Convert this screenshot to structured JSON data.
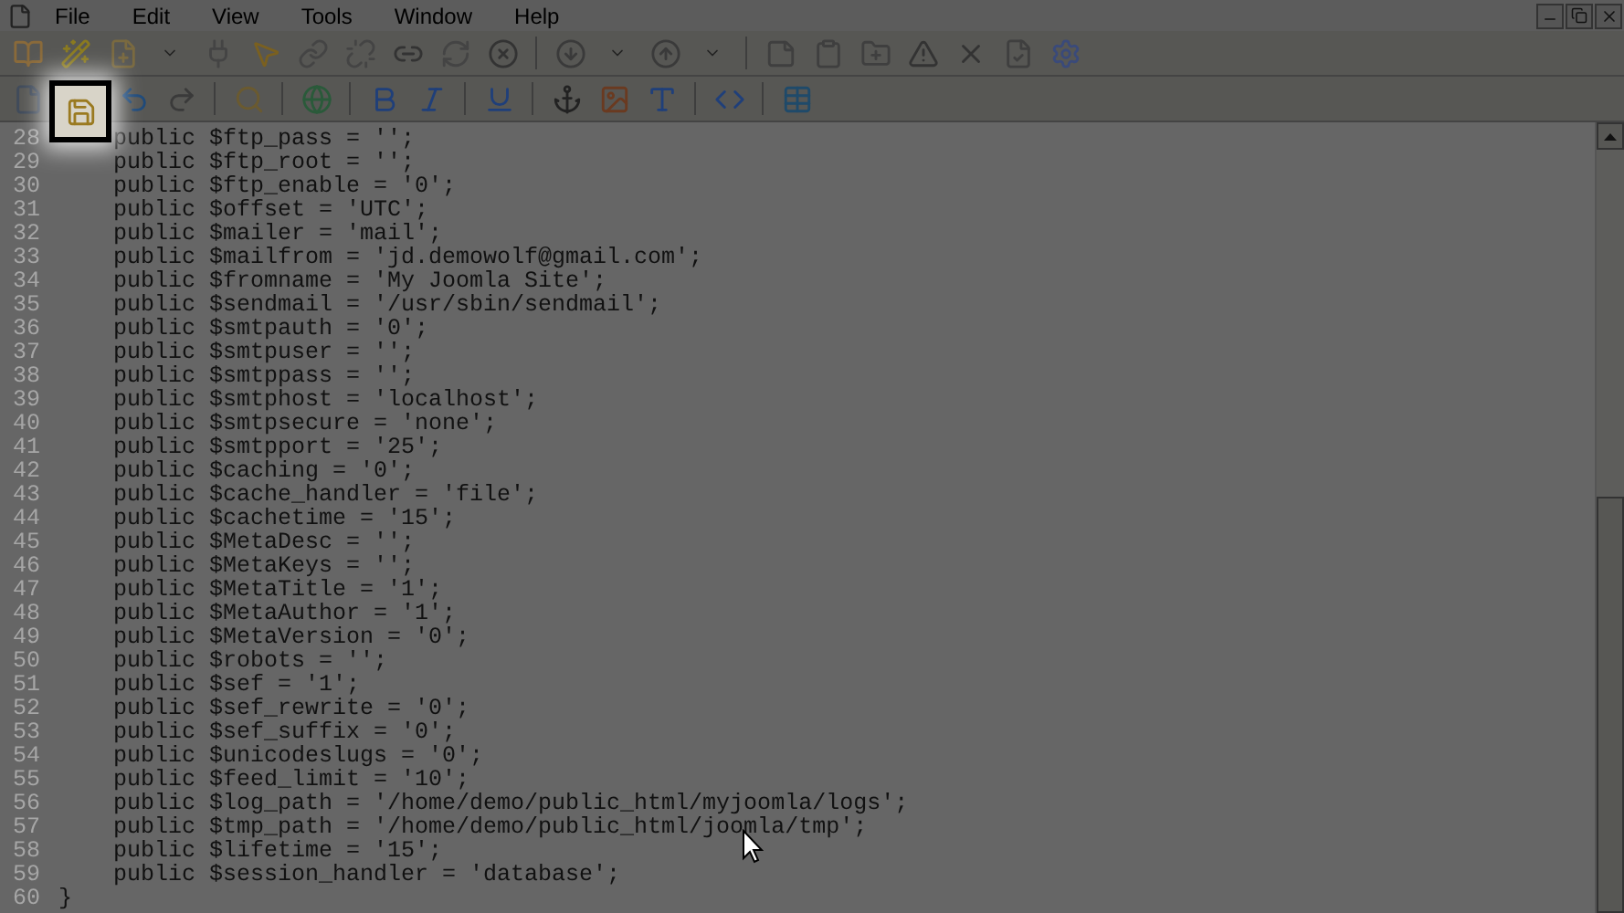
{
  "menu": [
    "File",
    "Edit",
    "View",
    "Tools",
    "Window",
    "Help"
  ],
  "toolbar_1": [
    {
      "kind": "book",
      "highlighted": false
    },
    {
      "kind": "wand",
      "highlighted": false
    },
    {
      "kind": "newfile",
      "highlighted": false
    },
    {
      "kind": "caret",
      "highlighted": false
    },
    {
      "kind": "plug",
      "highlighted": false
    },
    {
      "kind": "pointer",
      "highlighted": false
    },
    {
      "kind": "link",
      "highlighted": false
    },
    {
      "kind": "unlink",
      "highlighted": false
    },
    {
      "kind": "url",
      "highlighted": false
    },
    {
      "kind": "refresh",
      "highlighted": false
    },
    {
      "kind": "stop",
      "highlighted": false
    },
    {
      "kind": "sep"
    },
    {
      "kind": "down",
      "highlighted": false
    },
    {
      "kind": "caret",
      "highlighted": false
    },
    {
      "kind": "up",
      "highlighted": false
    },
    {
      "kind": "caret",
      "highlighted": false
    },
    {
      "kind": "sep"
    },
    {
      "kind": "notes",
      "highlighted": false
    },
    {
      "kind": "clipboard",
      "highlighted": false
    },
    {
      "kind": "folder",
      "highlighted": false
    },
    {
      "kind": "alert",
      "highlighted": false
    },
    {
      "kind": "close",
      "highlighted": false
    },
    {
      "kind": "check",
      "highlighted": false
    },
    {
      "kind": "gear",
      "highlighted": false
    }
  ],
  "toolbar_2": [
    {
      "kind": "page",
      "highlighted": false
    },
    {
      "kind": "save",
      "highlighted": true
    },
    {
      "kind": "undo",
      "highlighted": false
    },
    {
      "kind": "redo",
      "highlighted": false
    },
    {
      "kind": "sep"
    },
    {
      "kind": "find",
      "highlighted": false
    },
    {
      "kind": "sep"
    },
    {
      "kind": "globe",
      "highlighted": false
    },
    {
      "kind": "sep"
    },
    {
      "kind": "bold",
      "highlighted": false
    },
    {
      "kind": "italic",
      "highlighted": false
    },
    {
      "kind": "sep"
    },
    {
      "kind": "underline",
      "highlighted": false
    },
    {
      "kind": "sep"
    },
    {
      "kind": "anchor",
      "highlighted": false
    },
    {
      "kind": "image",
      "highlighted": false
    },
    {
      "kind": "font",
      "highlighted": false
    },
    {
      "kind": "sep"
    },
    {
      "kind": "code",
      "highlighted": false
    },
    {
      "kind": "sep"
    },
    {
      "kind": "table",
      "highlighted": false
    }
  ],
  "code_lines": [
    {
      "number": "28",
      "text": "    public $ftp_pass = '';"
    },
    {
      "number": "29",
      "text": "    public $ftp_root = '';"
    },
    {
      "number": "30",
      "text": "    public $ftp_enable = '0';"
    },
    {
      "number": "31",
      "text": "    public $offset = 'UTC';"
    },
    {
      "number": "32",
      "text": "    public $mailer = 'mail';"
    },
    {
      "number": "33",
      "text": "    public $mailfrom = 'jd.demowolf@gmail.com';"
    },
    {
      "number": "34",
      "text": "    public $fromname = 'My Joomla Site';"
    },
    {
      "number": "35",
      "text": "    public $sendmail = '/usr/sbin/sendmail';"
    },
    {
      "number": "36",
      "text": "    public $smtpauth = '0';"
    },
    {
      "number": "37",
      "text": "    public $smtpuser = '';"
    },
    {
      "number": "38",
      "text": "    public $smtppass = '';"
    },
    {
      "number": "39",
      "text": "    public $smtphost = 'localhost';"
    },
    {
      "number": "40",
      "text": "    public $smtpsecure = 'none';"
    },
    {
      "number": "41",
      "text": "    public $smtpport = '25';"
    },
    {
      "number": "42",
      "text": "    public $caching = '0';"
    },
    {
      "number": "43",
      "text": "    public $cache_handler = 'file';"
    },
    {
      "number": "44",
      "text": "    public $cachetime = '15';"
    },
    {
      "number": "45",
      "text": "    public $MetaDesc = '';"
    },
    {
      "number": "46",
      "text": "    public $MetaKeys = '';"
    },
    {
      "number": "47",
      "text": "    public $MetaTitle = '1';"
    },
    {
      "number": "48",
      "text": "    public $MetaAuthor = '1';"
    },
    {
      "number": "49",
      "text": "    public $MetaVersion = '0';"
    },
    {
      "number": "50",
      "text": "    public $robots = '';"
    },
    {
      "number": "51",
      "text": "    public $sef = '1';"
    },
    {
      "number": "52",
      "text": "    public $sef_rewrite = '0';"
    },
    {
      "number": "53",
      "text": "    public $sef_suffix = '0';"
    },
    {
      "number": "54",
      "text": "    public $unicodeslugs = '0';"
    },
    {
      "number": "55",
      "text": "    public $feed_limit = '10';"
    },
    {
      "number": "56",
      "text": "    public $log_path = '/home/demo/public_html/myjoomla/logs';"
    },
    {
      "number": "57",
      "text": "    public $tmp_path = '/home/demo/public_html/joomla/tmp';"
    },
    {
      "number": "58",
      "text": "    public $lifetime = '15';"
    },
    {
      "number": "59",
      "text": "    public $session_handler = 'database';"
    },
    {
      "number": "60",
      "text": "}"
    }
  ]
}
